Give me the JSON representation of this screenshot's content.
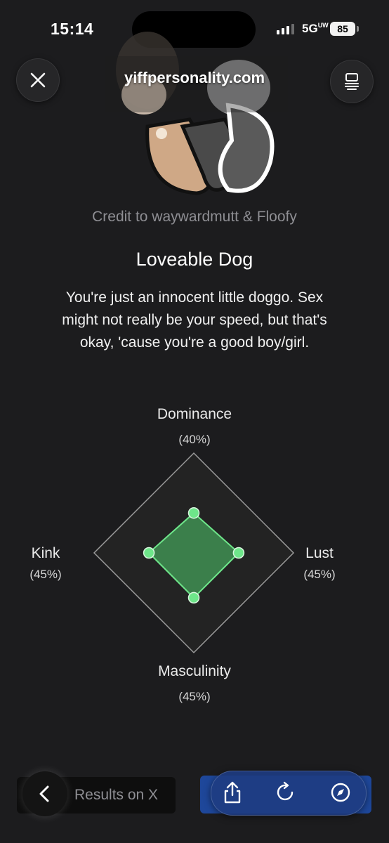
{
  "status_bar": {
    "time": "15:14",
    "network": "5G",
    "network_suffix": "UW",
    "battery": "85"
  },
  "browser": {
    "url": "yiffpersonality.com",
    "close_icon": "close-icon",
    "reader_icon": "reader-mode-icon"
  },
  "result": {
    "credit": "Credit to waywardmutt & Floofy",
    "title": "Loveable Dog",
    "description": "You're just an innocent little doggo. Sex might not really be your speed, but that's okay, 'cause you're a good boy/girl."
  },
  "chart_data": {
    "type": "radar",
    "axes": [
      {
        "label": "Dominance",
        "value_text": "(40%)",
        "value": 40
      },
      {
        "label": "Lust",
        "value_text": "(45%)",
        "value": 45
      },
      {
        "label": "Masculinity",
        "value_text": "(45%)",
        "value": 45
      },
      {
        "label": "Kink",
        "value_text": "(45%)",
        "value": 45
      }
    ],
    "range": [
      0,
      100
    ],
    "fill_color": "#3f8f52",
    "line_color": "#6ee68a"
  },
  "bottom": {
    "results_label": "Results on X"
  },
  "colors": {
    "background": "#1c1c1e",
    "accent_blue": "#1f4fb0"
  }
}
